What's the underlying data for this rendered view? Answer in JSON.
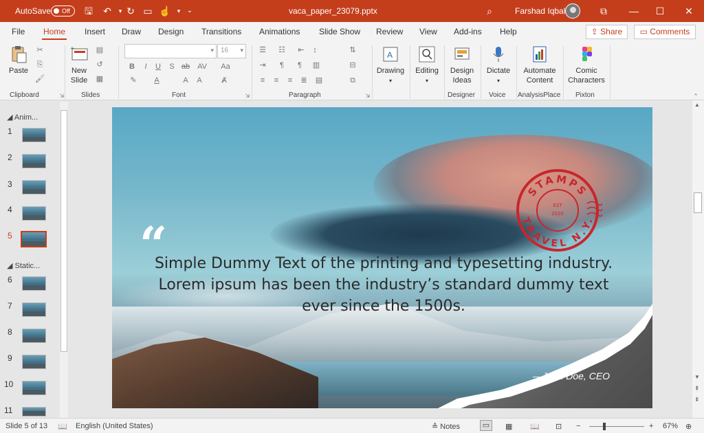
{
  "titlebar": {
    "autosave_label": "AutoSave",
    "autosave_state": "Off",
    "filename": "vaca_paper_23079.pptx",
    "user": "Farshad Iqbal",
    "accent": "#c43e1c"
  },
  "menu": {
    "tabs": [
      "File",
      "Home",
      "Insert",
      "Draw",
      "Design",
      "Transitions",
      "Animations",
      "Slide Show",
      "Review",
      "View",
      "Add-ins",
      "Help"
    ],
    "active": "Home",
    "share": "Share",
    "comments": "Comments"
  },
  "ribbon": {
    "clipboard": {
      "paste": "Paste",
      "label": "Clipboard"
    },
    "slides": {
      "new_slide": "New",
      "new_slide2": "Slide",
      "label": "Slides"
    },
    "font": {
      "font_name": "",
      "font_size": "16",
      "label": "Font"
    },
    "paragraph": {
      "label": "Paragraph"
    },
    "drawing": {
      "drawing": "Drawing",
      "editing": "Editing"
    },
    "designer": {
      "ideas1": "Design",
      "ideas2": "Ideas",
      "label": "Designer"
    },
    "voice": {
      "dictate": "Dictate",
      "label": "Voice"
    },
    "analysis": {
      "automate1": "Automate",
      "automate2": "Content",
      "label": "AnalysisPlace"
    },
    "pixton": {
      "comic1": "Comic",
      "comic2": "Characters",
      "label": "Pixton"
    }
  },
  "slides_panel": {
    "sections": [
      "Anim...",
      "Static..."
    ],
    "numbers": [
      "1",
      "2",
      "3",
      "4",
      "5",
      "6",
      "7",
      "8",
      "9",
      "10",
      "11"
    ],
    "selected": "5"
  },
  "slide": {
    "quote": "Simple Dummy Text of the printing and typesetting industry. Lorem ipsum has been the industry’s standard dummy text ever since the 1500s.",
    "author": "—John Doe, CEO",
    "stamp_top": "STAMPS",
    "stamp_bottom": "TRAVEL N.Y.",
    "stamp_est": "EST",
    "stamp_year": "2020"
  },
  "status": {
    "slide_info": "Slide 5 of 13",
    "language": "English (United States)",
    "notes": "Notes",
    "zoom": "67%"
  }
}
